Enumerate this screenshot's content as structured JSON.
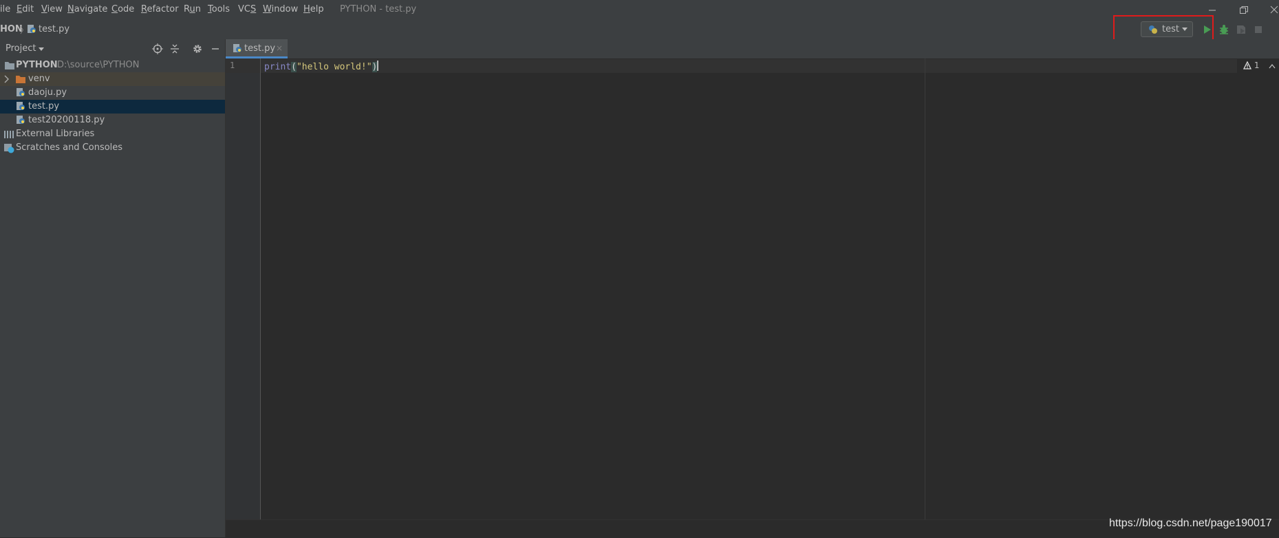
{
  "menu": {
    "items": [
      {
        "pre": "",
        "mnemonic": "F",
        "post": "ile",
        "display_pre": "",
        "display_mn": "",
        "display_post": "ile"
      },
      {
        "pre": "",
        "mnemonic": "E",
        "post": "dit"
      },
      {
        "pre": "",
        "mnemonic": "V",
        "post": "iew"
      },
      {
        "pre": "",
        "mnemonic": "N",
        "post": "avigate"
      },
      {
        "pre": "",
        "mnemonic": "C",
        "post": "ode"
      },
      {
        "pre": "",
        "mnemonic": "R",
        "post": "efactor"
      },
      {
        "pre": "R",
        "mnemonic": "u",
        "post": "n"
      },
      {
        "pre": "",
        "mnemonic": "T",
        "post": "ools"
      },
      {
        "pre": "VC",
        "mnemonic": "S",
        "post": ""
      },
      {
        "pre": "",
        "mnemonic": "W",
        "post": "indow"
      },
      {
        "pre": "",
        "mnemonic": "H",
        "post": "elp"
      }
    ],
    "window_title": "PYTHON - test.py"
  },
  "navbar": {
    "root": "HON",
    "file": "test.py"
  },
  "run_config": {
    "label": "test"
  },
  "project_panel": {
    "title": "Project",
    "tree": {
      "root_name": "PYTHON",
      "root_path": "D:\\source\\PYTHON",
      "venv": "venv",
      "daoju": "daoju.py",
      "test": "test.py",
      "test2": "test20200118.py",
      "external": "External Libraries",
      "scratches": "Scratches and Consoles"
    }
  },
  "editor": {
    "tab_label": "test.py",
    "tab_close": "×",
    "line_number": "1",
    "code": {
      "fn": "print",
      "open": "(",
      "str": "\"hello world!\"",
      "close": ")"
    },
    "warning_count": "1"
  },
  "watermark": "https://blog.csdn.net/page190017",
  "colors": {
    "highlight_box": "#e01b1b",
    "run_green": "#499c54",
    "selection": "#0d293e",
    "tab_underline": "#4a88c7"
  }
}
